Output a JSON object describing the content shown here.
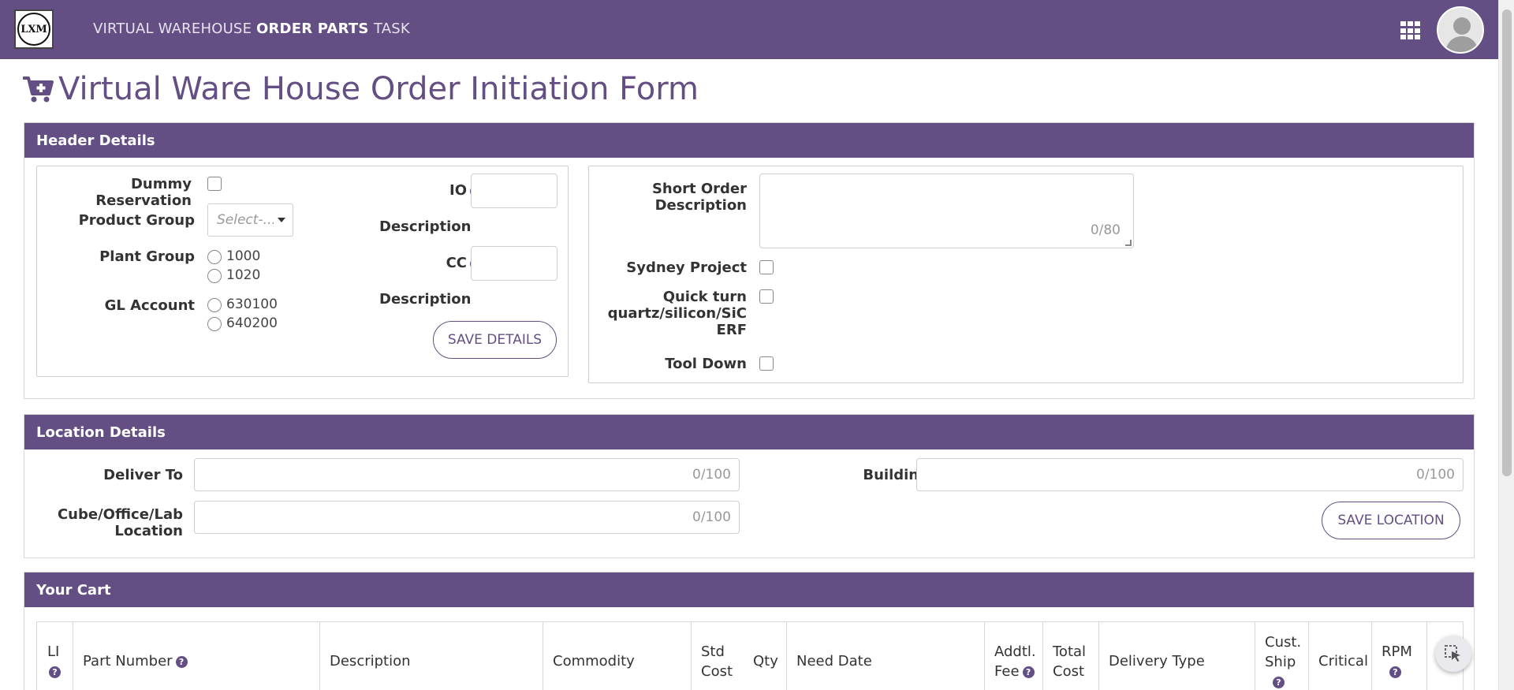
{
  "nav": {
    "logo_text": "LXM",
    "links": [
      "VIRTUAL WAREHOUSE",
      "ORDER PARTS",
      "TASK"
    ],
    "active": "ORDER PARTS"
  },
  "page": {
    "title": "Virtual Ware House Order Initiation Form"
  },
  "header_details": {
    "title": "Header Details",
    "dummy_reservation_label": "Dummy Reservation",
    "product_group_label": "Product Group",
    "product_group_placeholder": "Select-...",
    "plant_group_label": "Plant Group",
    "plant_group_options": [
      "1000",
      "1020"
    ],
    "gl_account_label": "GL Account",
    "gl_account_options": [
      "630100",
      "640200"
    ],
    "io_label": "IO",
    "io_description_label": "Description",
    "cc_label": "CC",
    "cc_description_label": "Description",
    "save_button": "SAVE DETAILS",
    "short_order_label_1": "Short Order",
    "short_order_label_2": "Description",
    "short_order_counter": "0/80",
    "sydney_project_label": "Sydney Project",
    "quick_turn_label_1": "Quick turn",
    "quick_turn_label_2": "quartz/silicon/SiC",
    "quick_turn_label_3": "ERF",
    "tool_down_label": "Tool Down"
  },
  "location_details": {
    "title": "Location Details",
    "deliver_to_label": "Deliver To",
    "deliver_to_counter": "0/100",
    "cube_label_1": "Cube/Office/Lab",
    "cube_label_2": "Location",
    "cube_counter": "0/100",
    "building_label": "Building",
    "building_counter": "0/100",
    "save_button": "SAVE LOCATION"
  },
  "cart": {
    "title": "Your Cart",
    "columns": {
      "li": "LI",
      "part_number": "Part Number",
      "description": "Description",
      "commodity": "Commodity",
      "std_cost_1": "Std",
      "std_cost_2": "Cost",
      "qty": "Qty",
      "need_date": "Need Date",
      "addtl_fee_1": "Addtl.",
      "addtl_fee_2": "Fee",
      "total_cost_1": "Total",
      "total_cost_2": "Cost",
      "delivery_type": "Delivery Type",
      "cust_ship_1": "Cust.",
      "cust_ship_2": "Ship",
      "critical": "Critical",
      "rpm": "RPM"
    }
  },
  "colors": {
    "brand": "#634f84"
  },
  "icons": [
    "cart-plus-icon",
    "apps-grid-icon",
    "help-icon",
    "caret-down-icon",
    "pointer-select-icon"
  ]
}
